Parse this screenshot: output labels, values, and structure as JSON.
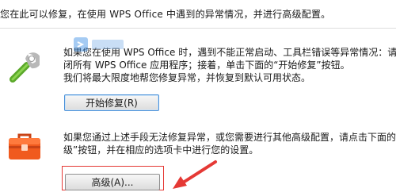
{
  "intro_text": "您在此可以修复，在使用 WPS Office 中遇到的异常情况，并进行高级配置。",
  "repair": {
    "line1": "如果您在使用 WPS Office 时，遇到不能正常启动、工具栏错误等异常情况：请",
    "line2": "闭所有 WPS Office 应用程序；接着，单击下面的“开始修复”按钮。",
    "line3": "我们将最大限度地帮您修复异常，并恢复到默认可用状态。",
    "button_label": "开始修复(R)"
  },
  "advanced": {
    "line1": "如果您通过上述手段无法修复异常，或您需要进行其他高级配置，请点击下面的",
    "line2": "级”按钮，并在相应的选项卡中进行您的设置。",
    "button_label": "高级(A)..."
  },
  "icons": {
    "repair_icon": "wrench-icon",
    "advanced_icon": "toolbox-icon",
    "annotation_arrow": "arrow-icon"
  },
  "colors": {
    "wrench_green": "#5aa82a",
    "toolbox_orange": "#f05a1e",
    "highlight_red": "#e53935",
    "button_focus_blue": "#4a90d9"
  }
}
